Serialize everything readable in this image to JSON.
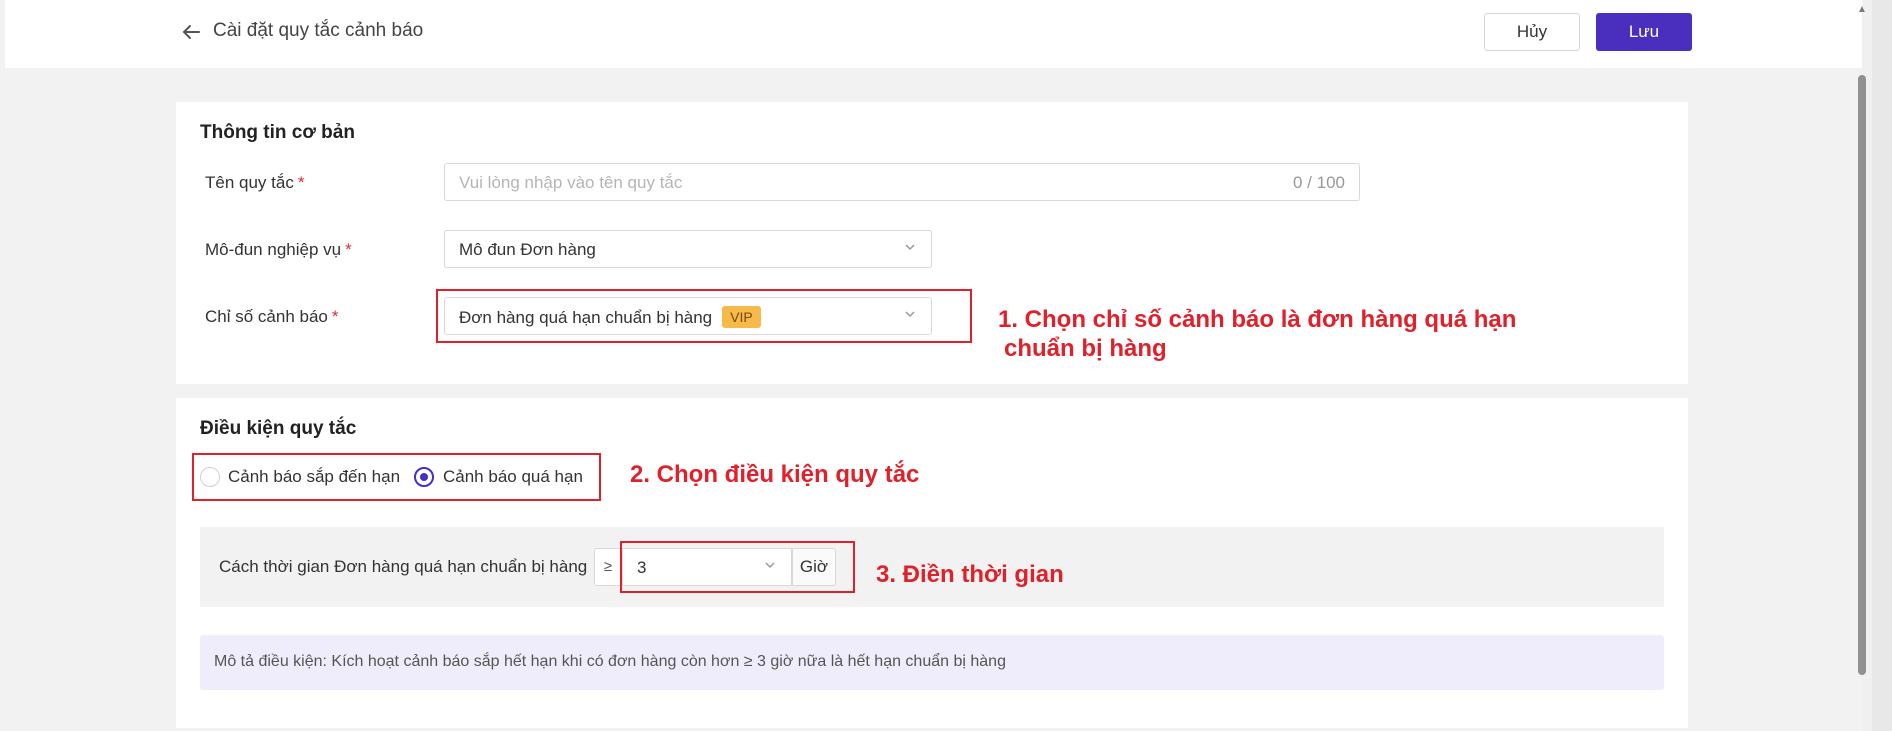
{
  "header": {
    "title": "Cài đặt quy tắc cảnh báo",
    "cancel_label": "Hủy",
    "save_label": "Lưu"
  },
  "basic_info": {
    "title": "Thông tin cơ bản",
    "rule_name": {
      "label": "Tên quy tắc",
      "required": "*",
      "placeholder": "Vui lòng nhập vào tên quy tắc",
      "counter": "0 / 100"
    },
    "module": {
      "label": "Mô-đun nghiệp vụ",
      "required": "*",
      "value": "Mô đun Đơn hàng"
    },
    "indicator": {
      "label": "Chỉ số cảnh báo",
      "required": "*",
      "value": "Đơn hàng quá hạn chuẩn bị hàng",
      "badge": "VIP"
    }
  },
  "rule_conditions": {
    "title": "Điều kiện quy tắc",
    "options": [
      {
        "label": "Cảnh báo sắp đến hạn",
        "selected": false
      },
      {
        "label": "Cảnh báo quá hạn",
        "selected": true
      }
    ],
    "time_condition": {
      "label": "Cách thời gian Đơn hàng quá hạn chuẩn bị hàng",
      "operator": "≥",
      "value": "3",
      "unit": "Giờ"
    },
    "description": "Mô tả điều kiện: Kích hoạt cảnh báo sắp hết hạn khi có đơn hàng còn hơn ≥ 3 giờ nữa là hết hạn chuẩn bị hàng"
  },
  "annotations": {
    "step1_line1": "1. Chọn chỉ số cảnh báo là đơn hàng quá hạn",
    "step1_line2": "chuẩn bị hàng",
    "step2": "2. Chọn điều kiện quy tắc",
    "step3": "3. Điền thời gian"
  },
  "colors": {
    "accent": "#4a2fbf",
    "annotation_red": "#e0202a",
    "vip_badge": "#f6b94a"
  }
}
